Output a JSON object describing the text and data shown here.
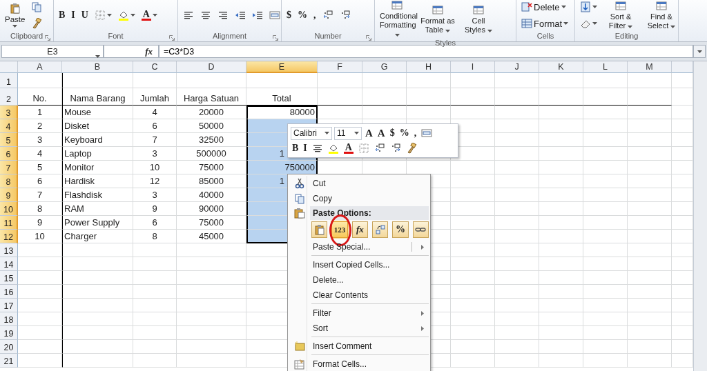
{
  "ribbon": {
    "groups": [
      {
        "label": "Clipboard",
        "controls": [
          {
            "kind": "paste",
            "label": "Paste"
          },
          {
            "kind": "copy"
          },
          {
            "kind": "painter"
          }
        ]
      },
      {
        "label": "Font",
        "controls": [
          {
            "kind": "glyph",
            "label": "B"
          },
          {
            "kind": "glyph",
            "label": "I"
          },
          {
            "kind": "glyph",
            "label": "U"
          },
          {
            "kind": "borders"
          },
          {
            "kind": "fill"
          },
          {
            "kind": "fontcolor",
            "label": "A"
          }
        ]
      },
      {
        "label": "Alignment",
        "controls": [
          {
            "kind": "align-left"
          },
          {
            "kind": "align-center"
          },
          {
            "kind": "align-right"
          },
          {
            "kind": "indent-dec"
          },
          {
            "kind": "indent-inc"
          },
          {
            "kind": "merge"
          }
        ]
      },
      {
        "label": "Number",
        "controls": [
          {
            "kind": "glyph",
            "label": "$"
          },
          {
            "kind": "glyph",
            "label": "%"
          },
          {
            "kind": "glyph",
            "label": ","
          },
          {
            "kind": "dec-inc"
          },
          {
            "kind": "dec-dec"
          }
        ]
      },
      {
        "label": "Styles",
        "controls": [
          {
            "kind": "large",
            "label": "Conditional Formatting"
          },
          {
            "kind": "large",
            "label": "Format as Table"
          },
          {
            "kind": "large",
            "label": "Cell Styles"
          }
        ]
      },
      {
        "label": "Cells",
        "controls": [
          {
            "kind": "row-delete",
            "label": "Delete"
          },
          {
            "kind": "row-format",
            "label": "Format"
          }
        ]
      },
      {
        "label": "Editing",
        "controls": [
          {
            "kind": "fill-down"
          },
          {
            "kind": "eraser"
          },
          {
            "kind": "large",
            "label": "Sort & Filter"
          },
          {
            "kind": "large",
            "label": "Find & Select"
          }
        ]
      }
    ]
  },
  "formula_bar": {
    "name_box": "E3",
    "function_label": "fx",
    "formula": "=C3*D3"
  },
  "columns": [
    {
      "label": "A",
      "selected": false
    },
    {
      "label": "B",
      "selected": false
    },
    {
      "label": "C",
      "selected": false
    },
    {
      "label": "D",
      "selected": false
    },
    {
      "label": "E",
      "selected": true
    },
    {
      "label": "F",
      "selected": false
    },
    {
      "label": "G",
      "selected": false
    },
    {
      "label": "H",
      "selected": false
    },
    {
      "label": "I",
      "selected": false
    },
    {
      "label": "J",
      "selected": false
    },
    {
      "label": "K",
      "selected": false
    },
    {
      "label": "L",
      "selected": false
    },
    {
      "label": "M",
      "selected": false
    }
  ],
  "row_headers": [
    {
      "label": "1",
      "selected": false
    },
    {
      "label": "2",
      "selected": false
    },
    {
      "label": "3",
      "selected": true
    },
    {
      "label": "4",
      "selected": true
    },
    {
      "label": "5",
      "selected": true
    },
    {
      "label": "6",
      "selected": true
    },
    {
      "label": "7",
      "selected": true
    },
    {
      "label": "8",
      "selected": true
    },
    {
      "label": "9",
      "selected": true
    },
    {
      "label": "10",
      "selected": true
    },
    {
      "label": "11",
      "selected": true
    },
    {
      "label": "12",
      "selected": true
    },
    {
      "label": "13",
      "selected": false
    },
    {
      "label": "14",
      "selected": false
    },
    {
      "label": "15",
      "selected": false
    },
    {
      "label": "16",
      "selected": false
    },
    {
      "label": "17",
      "selected": false
    },
    {
      "label": "18",
      "selected": false
    },
    {
      "label": "19",
      "selected": false
    },
    {
      "label": "20",
      "selected": false
    },
    {
      "label": "21",
      "selected": false
    }
  ],
  "table": {
    "header": [
      "No.",
      "Nama Barang",
      "Jumlah",
      "Harga Satuan",
      "Total"
    ],
    "rows": [
      {
        "no": "1",
        "item": "Mouse",
        "qty": "4",
        "price": "20000",
        "total": "80000",
        "selected": true,
        "active": true,
        "covered": false
      },
      {
        "no": "2",
        "item": "Disket",
        "qty": "6",
        "price": "50000",
        "selected": true,
        "active": false,
        "covered": true
      },
      {
        "no": "3",
        "item": "Keyboard",
        "qty": "7",
        "price": "32500",
        "selected": true,
        "active": false,
        "covered": true
      },
      {
        "no": "4",
        "item": "Laptop",
        "qty": "3",
        "price": "500000",
        "total": "1",
        "selected": true,
        "active": false,
        "covered": true
      },
      {
        "no": "5",
        "item": "Monitor",
        "qty": "10",
        "price": "75000",
        "total": "750000",
        "selected": true,
        "active": false,
        "covered": false
      },
      {
        "no": "6",
        "item": "Hardisk",
        "qty": "12",
        "price": "85000",
        "total": "1",
        "selected": true,
        "active": false,
        "covered": true
      },
      {
        "no": "7",
        "item": "Flashdisk",
        "qty": "3",
        "price": "40000",
        "selected": true,
        "active": false,
        "covered": true
      },
      {
        "no": "8",
        "item": "RAM",
        "qty": "9",
        "price": "90000",
        "selected": true,
        "active": false,
        "covered": true
      },
      {
        "no": "9",
        "item": "Power Supply",
        "qty": "6",
        "price": "75000",
        "selected": true,
        "active": false,
        "covered": true
      },
      {
        "no": "10",
        "item": "Charger",
        "qty": "8",
        "price": "45000",
        "selected": true,
        "active": false,
        "covered": true
      }
    ]
  },
  "mini_toolbar": {
    "font": "Calibri",
    "size": "11",
    "row1": [
      {
        "kind": "grow",
        "label": "A"
      },
      {
        "kind": "shrink",
        "label": "A"
      },
      {
        "kind": "glyph",
        "label": "$"
      },
      {
        "kind": "glyph",
        "label": "%"
      },
      {
        "kind": "glyph",
        "label": ","
      },
      {
        "kind": "merge"
      }
    ],
    "row2": [
      {
        "kind": "glyph",
        "label": "B"
      },
      {
        "kind": "glyph",
        "label": "I"
      },
      {
        "kind": "align-center"
      },
      {
        "kind": "fill"
      },
      {
        "kind": "fontcolor",
        "label": "A"
      },
      {
        "kind": "borders"
      },
      {
        "kind": "dec-inc"
      },
      {
        "kind": "dec-dec"
      },
      {
        "kind": "painter"
      }
    ]
  },
  "context_menu": {
    "items": [
      {
        "kind": "cut",
        "label": "Cut",
        "separator_before": false
      },
      {
        "kind": "copy",
        "label": "Copy",
        "separator_before": false
      },
      {
        "kind": "paste_header",
        "label": "Paste Options:",
        "separator_before": false
      },
      {
        "kind": "paste_options",
        "separator_before": false,
        "options": [
          {
            "kind": "paste",
            "selected": false,
            "circled": false
          },
          {
            "kind": "glyph",
            "label": "123",
            "selected": true,
            "circled": true
          },
          {
            "kind": "glyph",
            "label": "fx",
            "selected": false,
            "circled": false
          },
          {
            "kind": "transpose",
            "selected": false,
            "circled": false
          },
          {
            "kind": "glyph",
            "label": "%",
            "selected": false,
            "circled": false
          },
          {
            "kind": "link",
            "selected": false,
            "circled": false
          }
        ]
      },
      {
        "kind": "submenu",
        "label": "Paste Special...",
        "separator_before": false
      },
      {
        "kind": "plain",
        "label": "Insert Copied Cells...",
        "separator_before": true
      },
      {
        "kind": "plain",
        "label": "Delete...",
        "separator_before": false
      },
      {
        "kind": "plain",
        "label": "Clear Contents",
        "separator_before": false
      },
      {
        "kind": "submenu",
        "label": "Filter",
        "separator_before": true
      },
      {
        "kind": "submenu",
        "label": "Sort",
        "separator_before": false
      },
      {
        "kind": "comment",
        "label": "Insert Comment",
        "separator_before": true
      },
      {
        "kind": "format",
        "label": "Format Cells...",
        "separator_before": true
      }
    ]
  }
}
